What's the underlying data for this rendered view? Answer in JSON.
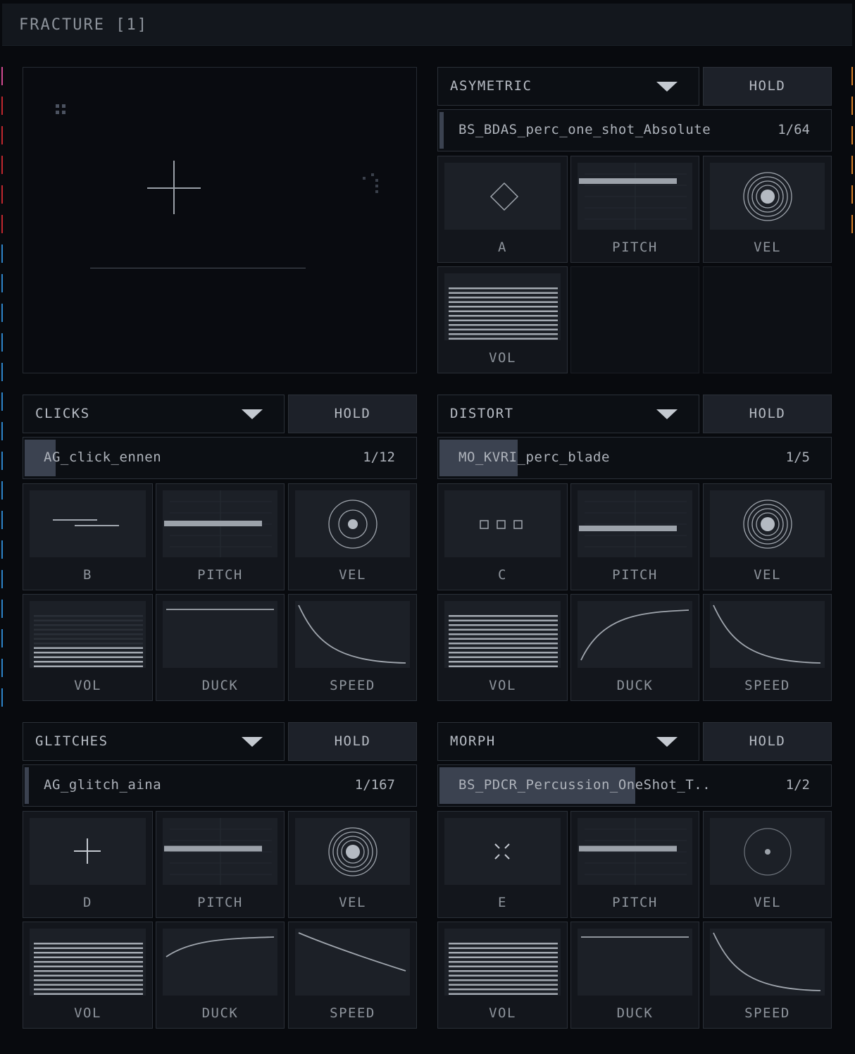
{
  "window": {
    "title": "FRACTURE [1]"
  },
  "colors": {
    "pink": "#d04a8f",
    "red": "#c0272e",
    "blue": "#2d84c9",
    "orange": "#d9812a"
  },
  "layers": [
    {
      "id": "a",
      "mode": "ASYMETRIC",
      "hold": "HOLD",
      "sample": "BS_BDAS_perc_one_shot_Absolute",
      "count": "1/64",
      "position": 0.01,
      "cells": [
        {
          "label": "A",
          "icon": "diamond-icon"
        },
        {
          "label": "PITCH",
          "icon": "pitch-bar-icon",
          "level": 0.2
        },
        {
          "label": "VEL",
          "icon": "vel-rings-icon",
          "rings": 4
        },
        {
          "label": "VOL",
          "icon": "vol-lines-icon",
          "level": 1.0
        }
      ]
    },
    {
      "id": "b",
      "mode": "CLICKS",
      "hold": "HOLD",
      "sample": "AG_click_ennen",
      "count": "1/12",
      "position": 0.08,
      "cells": [
        {
          "label": "B",
          "icon": "offset-lines-icon"
        },
        {
          "label": "PITCH",
          "icon": "pitch-bar-icon",
          "level": 0.5
        },
        {
          "label": "VEL",
          "icon": "vel-rings-icon",
          "rings": 2
        },
        {
          "label": "VOL",
          "icon": "vol-lines-icon",
          "level": 0.45
        },
        {
          "label": "DUCK",
          "icon": "duck-curve-icon",
          "curve": "flat"
        },
        {
          "label": "SPEED",
          "icon": "speed-curve-icon",
          "curve": "decay"
        }
      ]
    },
    {
      "id": "c",
      "mode": "DISTORT",
      "hold": "HOLD",
      "sample": "MO_KVRI_perc_blade",
      "count": "1/5",
      "position": 0.2,
      "cells": [
        {
          "label": "C",
          "icon": "three-squares-icon"
        },
        {
          "label": "PITCH",
          "icon": "pitch-bar-icon",
          "level": 0.6
        },
        {
          "label": "VEL",
          "icon": "vel-rings-icon",
          "rings": 4
        },
        {
          "label": "VOL",
          "icon": "vol-lines-icon",
          "level": 1.0
        },
        {
          "label": "DUCK",
          "icon": "duck-curve-icon",
          "curve": "rise"
        },
        {
          "label": "SPEED",
          "icon": "speed-curve-icon",
          "curve": "decay"
        }
      ]
    },
    {
      "id": "d",
      "mode": "GLITCHES",
      "hold": "HOLD",
      "sample": "AG_glitch_aina",
      "count": "1/167",
      "position": 0.005,
      "cells": [
        {
          "label": "D",
          "icon": "plus-icon"
        },
        {
          "label": "PITCH",
          "icon": "pitch-bar-icon",
          "level": 0.45
        },
        {
          "label": "VEL",
          "icon": "vel-rings-icon",
          "rings": 4
        },
        {
          "label": "VOL",
          "icon": "vol-lines-icon",
          "level": 1.0
        },
        {
          "label": "DUCK",
          "icon": "duck-curve-icon",
          "curve": "soft-rise"
        },
        {
          "label": "SPEED",
          "icon": "speed-curve-icon",
          "curve": "linear-fall"
        }
      ]
    },
    {
      "id": "e",
      "mode": "MORPH",
      "hold": "HOLD",
      "sample": "BS_PDCR_Percussion_OneShot_T..",
      "count": "1/2",
      "position": 0.5,
      "cells": [
        {
          "label": "E",
          "icon": "scatter-icon"
        },
        {
          "label": "PITCH",
          "icon": "pitch-bar-icon",
          "level": 0.45
        },
        {
          "label": "VEL",
          "icon": "vel-rings-icon",
          "rings": 1
        },
        {
          "label": "VOL",
          "icon": "vol-lines-icon",
          "level": 1.0
        },
        {
          "label": "DUCK",
          "icon": "duck-curve-icon",
          "curve": "flat"
        },
        {
          "label": "SPEED",
          "icon": "speed-curve-icon",
          "curve": "decay"
        }
      ]
    }
  ]
}
